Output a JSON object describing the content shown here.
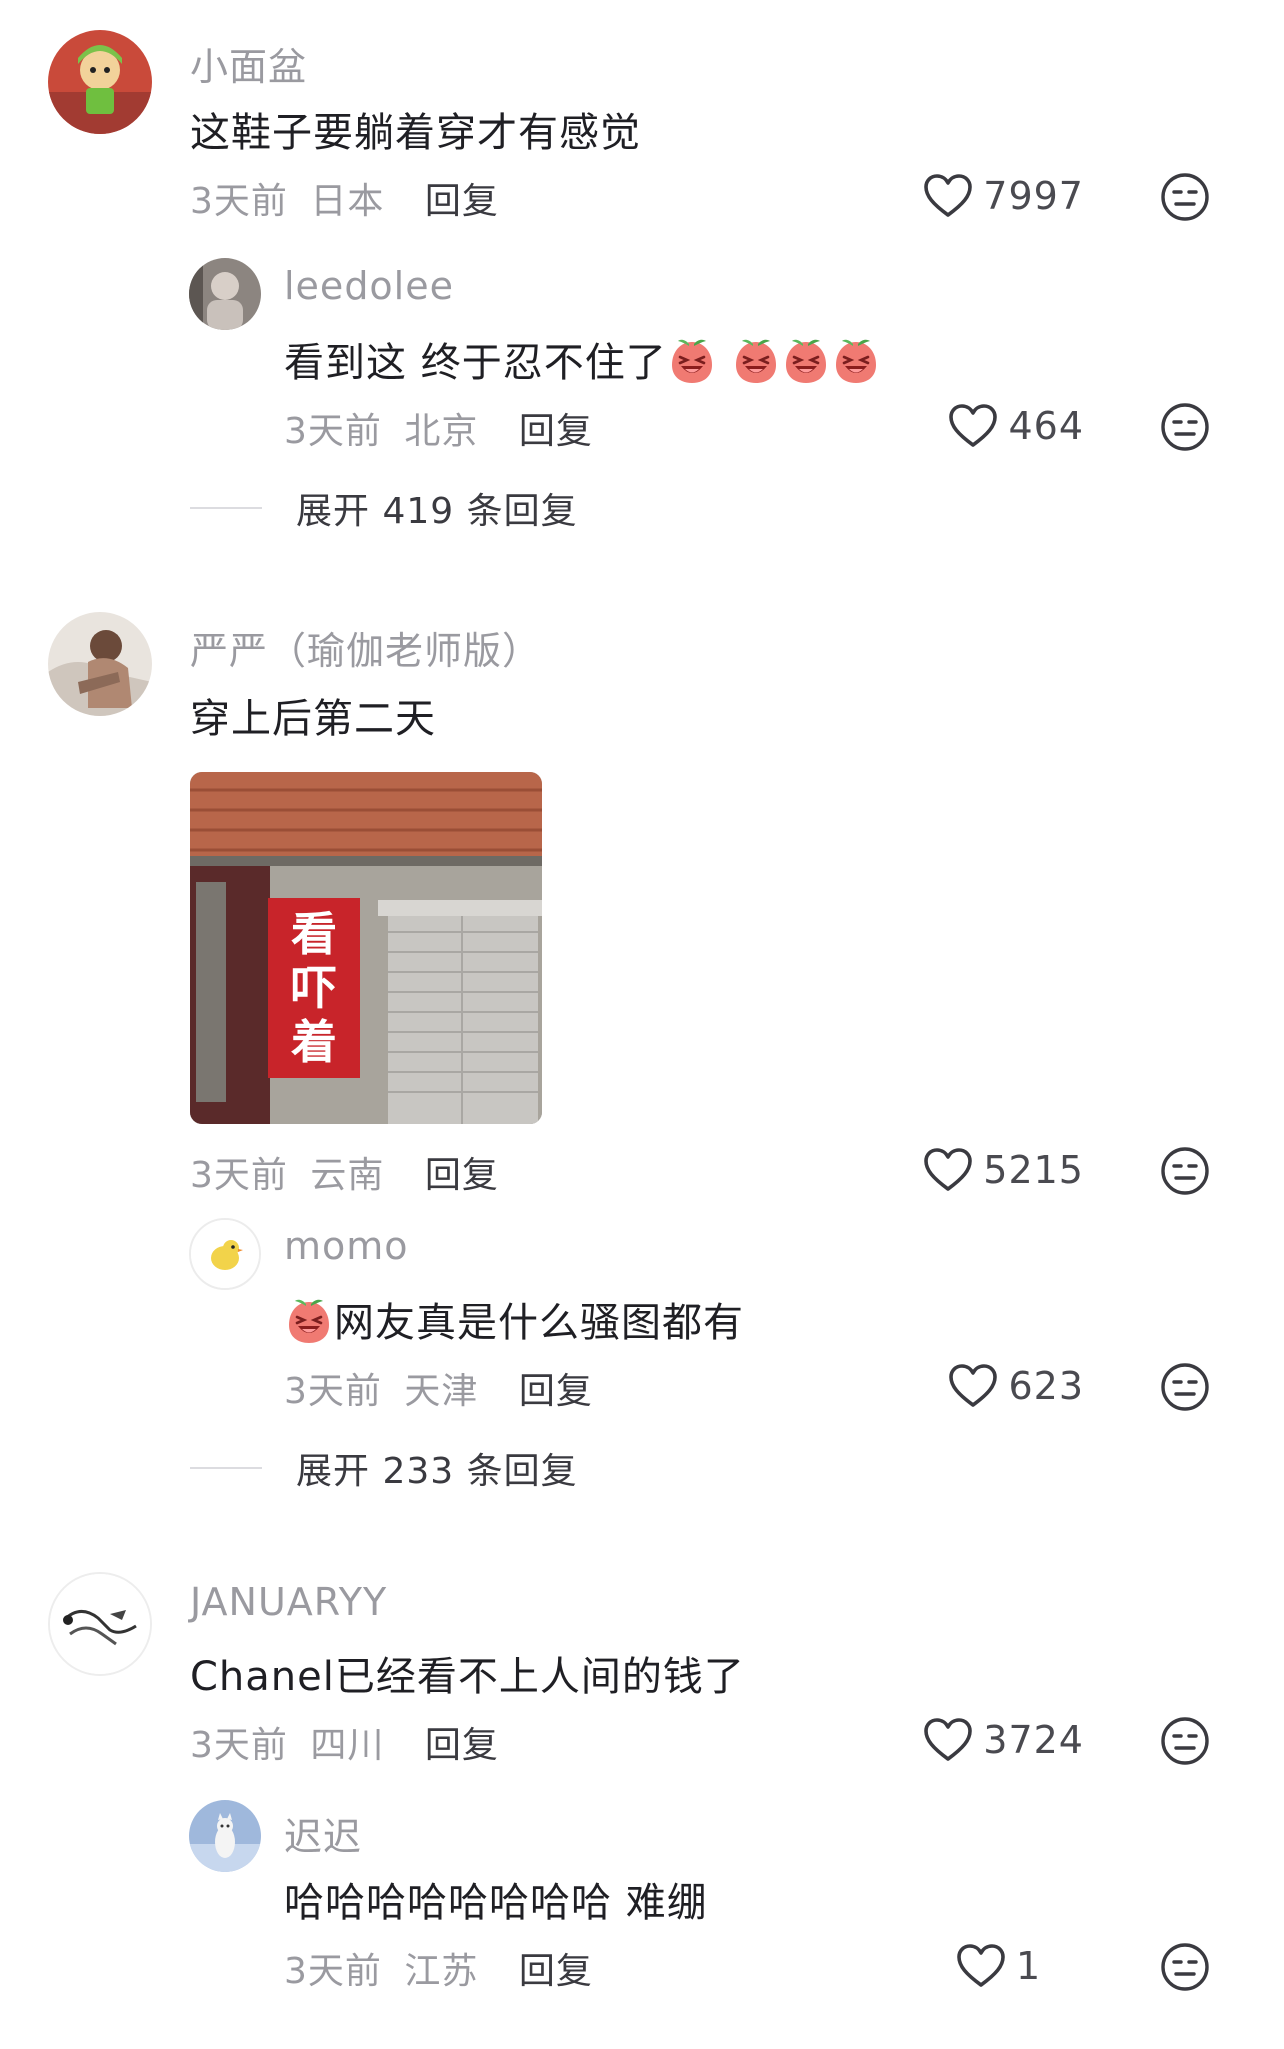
{
  "comments": [
    {
      "username": "小面盆",
      "text": "这鞋子要躺着穿才有感觉",
      "time": "3天前",
      "location": "日本",
      "reply_label": "回复",
      "likes": "7997",
      "replies": [
        {
          "username": "leedolee",
          "text": "看到这 终于忍不住了",
          "time": "3天前",
          "location": "北京",
          "reply_label": "回复",
          "likes": "464"
        }
      ],
      "expand_label": "展开 419 条回复"
    },
    {
      "username": "严严（瑜伽老师版）",
      "text": "穿上后第二天",
      "image_text": "看吓着",
      "time": "3天前",
      "location": "云南",
      "reply_label": "回复",
      "likes": "5215",
      "replies": [
        {
          "username": "momo",
          "text": "网友真是什么骚图都有",
          "time": "3天前",
          "location": "天津",
          "reply_label": "回复",
          "likes": "623"
        }
      ],
      "expand_label": "展开 233 条回复"
    },
    {
      "username": "JANUARYY",
      "text": "Chanel已经看不上人间的钱了",
      "time": "3天前",
      "location": "四川",
      "reply_label": "回复",
      "likes": "3724",
      "replies": [
        {
          "username": "迟迟",
          "text": "哈哈哈哈哈哈哈哈 难绷",
          "time": "3天前",
          "location": "江苏",
          "reply_label": "回复",
          "likes": "1"
        }
      ]
    }
  ],
  "icons": {
    "like": "heart-outline-icon",
    "dislike": "neutral-face-icon",
    "emoji": "laughing-peach-emoji"
  },
  "colors": {
    "username": "#9a9aa0",
    "text": "#1f1f24",
    "meta": "#9a9aa0",
    "action": "#3a3a40"
  }
}
